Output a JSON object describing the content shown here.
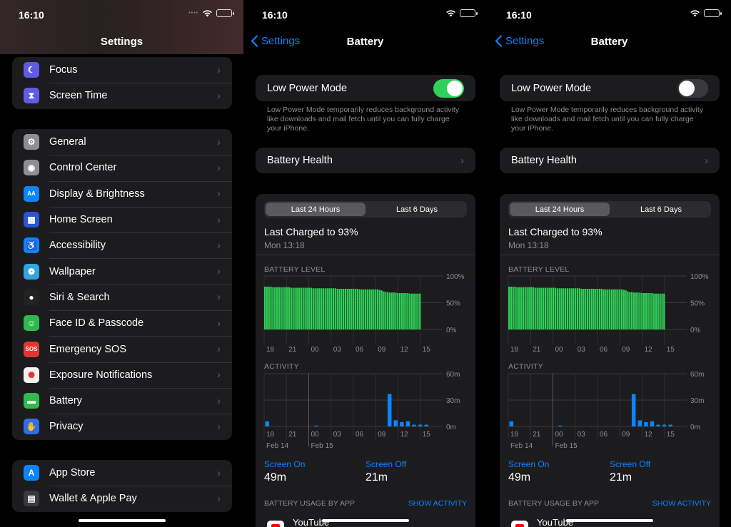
{
  "left": {
    "time": "16:10",
    "title": "Settings",
    "group1": [
      {
        "label": "Focus",
        "icon": "moon-icon",
        "color": "#5e5ce6",
        "glyph": "☾"
      },
      {
        "label": "Screen Time",
        "icon": "hourglass-icon",
        "color": "#5e5ce6",
        "glyph": "⧗"
      }
    ],
    "group2": [
      {
        "label": "General",
        "icon": "gear-icon",
        "color": "#8e8e93",
        "glyph": "⚙"
      },
      {
        "label": "Control Center",
        "icon": "toggles-icon",
        "color": "#8e8e93",
        "glyph": "◉"
      },
      {
        "label": "Display & Brightness",
        "icon": "text-size-icon",
        "color": "#0a84ff",
        "glyph": "AA"
      },
      {
        "label": "Home Screen",
        "icon": "app-grid-icon",
        "color": "#2c55d6",
        "glyph": "▦"
      },
      {
        "label": "Accessibility",
        "icon": "accessibility-icon",
        "color": "#0a84ff",
        "glyph": "♿"
      },
      {
        "label": "Wallpaper",
        "icon": "flower-icon",
        "color": "#30a5e0",
        "glyph": "❁"
      },
      {
        "label": "Siri & Search",
        "icon": "siri-icon",
        "color": "#222222",
        "glyph": "●"
      },
      {
        "label": "Face ID & Passcode",
        "icon": "face-id-icon",
        "color": "#30b94d",
        "glyph": "☺"
      },
      {
        "label": "Emergency SOS",
        "icon": "sos-icon",
        "color": "#e5342f",
        "glyph": "SOS"
      },
      {
        "label": "Exposure Notifications",
        "icon": "exposure-icon",
        "color": "#f2f2f2",
        "glyph": "✺"
      },
      {
        "label": "Battery",
        "icon": "battery-icon",
        "color": "#30b94d",
        "glyph": "▬"
      },
      {
        "label": "Privacy",
        "icon": "hand-icon",
        "color": "#2f6fe6",
        "glyph": "✋"
      }
    ],
    "group3": [
      {
        "label": "App Store",
        "icon": "app-store-icon",
        "color": "#0a84ff",
        "glyph": "A"
      },
      {
        "label": "Wallet & Apple Pay",
        "icon": "wallet-icon",
        "color": "#3a3a3c",
        "glyph": "▤"
      }
    ]
  },
  "battery_screens": [
    {
      "battery_color": "#ffd60a",
      "low_power_on": true
    },
    {
      "battery_color": "#ffffff",
      "low_power_on": false
    }
  ],
  "battery": {
    "time": "16:10",
    "back_label": "Settings",
    "title": "Battery",
    "low_power_label": "Low Power Mode",
    "low_power_desc": "Low Power Mode temporarily reduces background activity like downloads and mail fetch until you can fully charge your iPhone.",
    "health_label": "Battery Health",
    "seg_24h": "Last 24 Hours",
    "seg_6d": "Last 6 Days",
    "last_charged": "Last Charged to 93%",
    "last_charged_time": "Mon 13:18",
    "level_label": "BATTERY LEVEL",
    "activity_label": "ACTIVITY",
    "screen_on_label": "Screen On",
    "screen_on_value": "49m",
    "screen_off_label": "Screen Off",
    "screen_off_value": "21m",
    "usage_label": "BATTERY USAGE BY APP",
    "show_activity": "SHOW ACTIVITY",
    "top_app": "YouTube"
  },
  "chart_data": [
    {
      "type": "bar",
      "title": "BATTERY LEVEL",
      "x_ticks": [
        "18",
        "21",
        "00",
        "03",
        "06",
        "09",
        "12",
        "15"
      ],
      "y_ticks": [
        "100%",
        "50%",
        "0%"
      ],
      "ylim": [
        0,
        100
      ],
      "color": "#30d158",
      "values": [
        80,
        80,
        80,
        80,
        79,
        79,
        79,
        79,
        79,
        79,
        79,
        79,
        79,
        78,
        78,
        78,
        78,
        78,
        78,
        78,
        78,
        78,
        78,
        78,
        77,
        77,
        77,
        77,
        77,
        77,
        77,
        77,
        77,
        77,
        77,
        77,
        76,
        76,
        76,
        76,
        76,
        76,
        76,
        76,
        76,
        76,
        76,
        75,
        75,
        75,
        75,
        75,
        75,
        75,
        75,
        75,
        75,
        74,
        73,
        71,
        70,
        70,
        69,
        69,
        69,
        69,
        68,
        68,
        68,
        68,
        68,
        68,
        67,
        67,
        67,
        67,
        67,
        67
      ]
    },
    {
      "type": "bar",
      "title": "ACTIVITY",
      "x_ticks": [
        "18",
        "21",
        "00",
        "03",
        "06",
        "09",
        "12",
        "15"
      ],
      "x_date_labels": [
        "Feb 14",
        "Feb 15"
      ],
      "y_ticks": [
        "60m",
        "30m",
        "0m"
      ],
      "ylim": [
        0,
        60
      ],
      "color": "#0a84ff",
      "values": [
        6,
        0,
        0,
        0,
        0,
        0,
        0,
        0,
        1,
        0,
        0,
        0,
        0,
        0,
        0,
        0,
        0,
        0,
        0,
        0,
        37,
        7,
        5,
        6,
        2,
        2,
        2,
        0
      ]
    }
  ]
}
